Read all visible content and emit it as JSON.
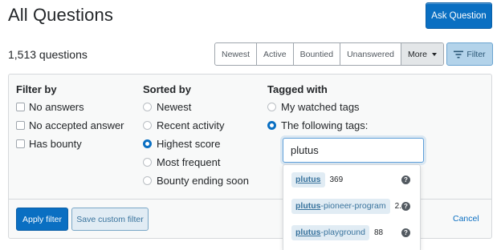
{
  "header": {
    "title": "All Questions",
    "ask_button": "Ask Question"
  },
  "toolbar": {
    "count": "1,513 questions",
    "sort_tabs": [
      "Newest",
      "Active",
      "Bountied",
      "Unanswered"
    ],
    "more_label": "More",
    "filter_label": "Filter"
  },
  "filter_panel": {
    "filter_by": {
      "heading": "Filter by",
      "options": [
        {
          "label": "No answers",
          "checked": false
        },
        {
          "label": "No accepted answer",
          "checked": false
        },
        {
          "label": "Has bounty",
          "checked": false
        }
      ]
    },
    "sorted_by": {
      "heading": "Sorted by",
      "options": [
        {
          "label": "Newest",
          "selected": false
        },
        {
          "label": "Recent activity",
          "selected": false
        },
        {
          "label": "Highest score",
          "selected": true
        },
        {
          "label": "Most frequent",
          "selected": false
        },
        {
          "label": "Bounty ending soon",
          "selected": false
        }
      ]
    },
    "tagged_with": {
      "heading": "Tagged with",
      "options": [
        {
          "label": "My watched tags",
          "selected": false
        },
        {
          "label": "The following tags:",
          "selected": true
        }
      ],
      "input_value": "plutus"
    },
    "suggestions": [
      {
        "match": "plutus",
        "rest": "",
        "count": "369"
      },
      {
        "match": "plutus",
        "rest": "-pioneer-program",
        "count": "2."
      },
      {
        "match": "plutus",
        "rest": "-playground",
        "count": "88"
      }
    ],
    "apply_label": "Apply filter",
    "save_label": "Save custom filter",
    "cancel_label": "Cancel"
  },
  "colors": {
    "primary": "#0a6fc2",
    "tag_bg": "#e1ecf4",
    "tag_text": "#39739d",
    "panel_bg": "#f8f9f9"
  }
}
